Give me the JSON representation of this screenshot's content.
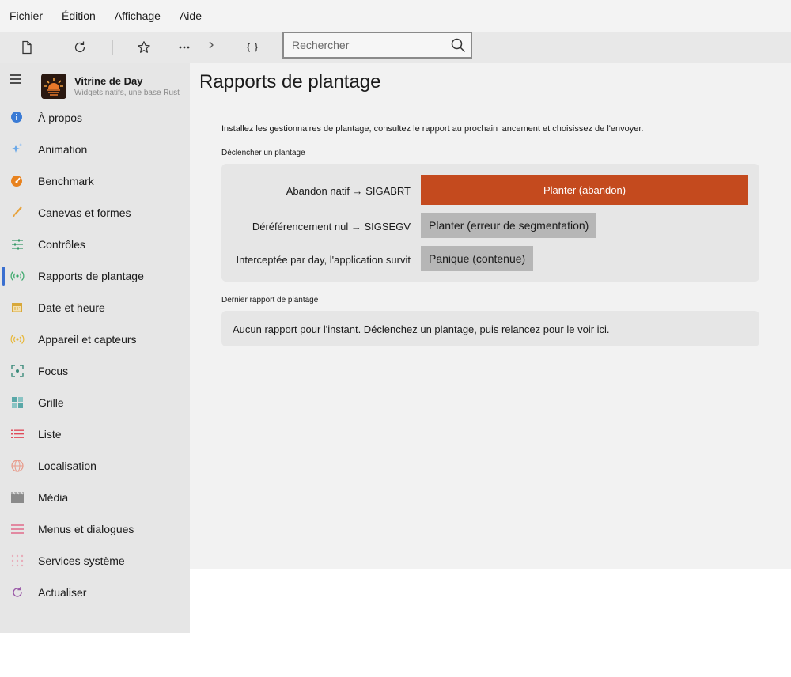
{
  "menubar": {
    "items": [
      "Fichier",
      "Édition",
      "Affichage",
      "Aide"
    ]
  },
  "toolbar": {
    "buttons": [
      "new-file-icon",
      "refresh-icon",
      "star-icon",
      "more-icon",
      "chevron-right-icon",
      "braces-icon"
    ],
    "search_placeholder": "Rechercher"
  },
  "sidebar": {
    "app_title": "Vitrine de Day",
    "app_subtitle": "Widgets natifs, une base Rust",
    "items": [
      {
        "label": "À propos",
        "icon": "info-icon",
        "color": "#3a7bd5"
      },
      {
        "label": "Animation",
        "icon": "sparkle-icon",
        "color": "#6aa8e8"
      },
      {
        "label": "Benchmark",
        "icon": "gauge-icon",
        "color": "#e8821e"
      },
      {
        "label": "Canevas et formes",
        "icon": "brush-icon",
        "color": "#e8a23a"
      },
      {
        "label": "Contrôles",
        "icon": "sliders-icon",
        "color": "#3a9a6a"
      },
      {
        "label": "Rapports de plantage",
        "icon": "broadcast-icon",
        "color": "#3aa86a",
        "active": true
      },
      {
        "label": "Date et heure",
        "icon": "calendar-icon",
        "color": "#d8a83a"
      },
      {
        "label": "Appareil et capteurs",
        "icon": "sensor-icon",
        "color": "#e8b83a"
      },
      {
        "label": "Focus",
        "icon": "focus-icon",
        "color": "#3a8a7a"
      },
      {
        "label": "Grille",
        "icon": "grid-icon",
        "color": "#5aa8a8"
      },
      {
        "label": "Liste",
        "icon": "list-icon",
        "color": "#e04a5a"
      },
      {
        "label": "Localisation",
        "icon": "globe-icon",
        "color": "#e89a8a"
      },
      {
        "label": "Média",
        "icon": "clapper-icon",
        "color": "#8a8a8a"
      },
      {
        "label": "Menus et dialogues",
        "icon": "menu-lines-icon",
        "color": "#e06a8a"
      },
      {
        "label": "Services système",
        "icon": "dots-grid-icon",
        "color": "#e8aab8"
      },
      {
        "label": "Actualiser",
        "icon": "reload-icon",
        "color": "#9a5aa8"
      }
    ]
  },
  "main": {
    "title": "Rapports de plantage",
    "description": "Installez les gestionnaires de plantage, consultez le rapport au prochain lancement et choisissez de l'envoyer.",
    "trigger_section": "Déclencher un plantage",
    "rows": [
      {
        "label": "Abandon natif → SIGABRT",
        "button": "Planter (abandon)"
      },
      {
        "label": "Déréférencement nul → SIGSEGV",
        "button": "Planter (erreur de segmentation)"
      },
      {
        "label": "Interceptée par day, l'application survit",
        "button": "Panique (contenue)"
      }
    ],
    "last_report_section": "Dernier rapport de plantage",
    "last_report_text": "Aucun rapport pour l'instant. Déclenchez un plantage, puis relancez pour le voir ici."
  },
  "colors": {
    "accent": "#c44a1e",
    "nav_active": "#3a6fd0"
  }
}
